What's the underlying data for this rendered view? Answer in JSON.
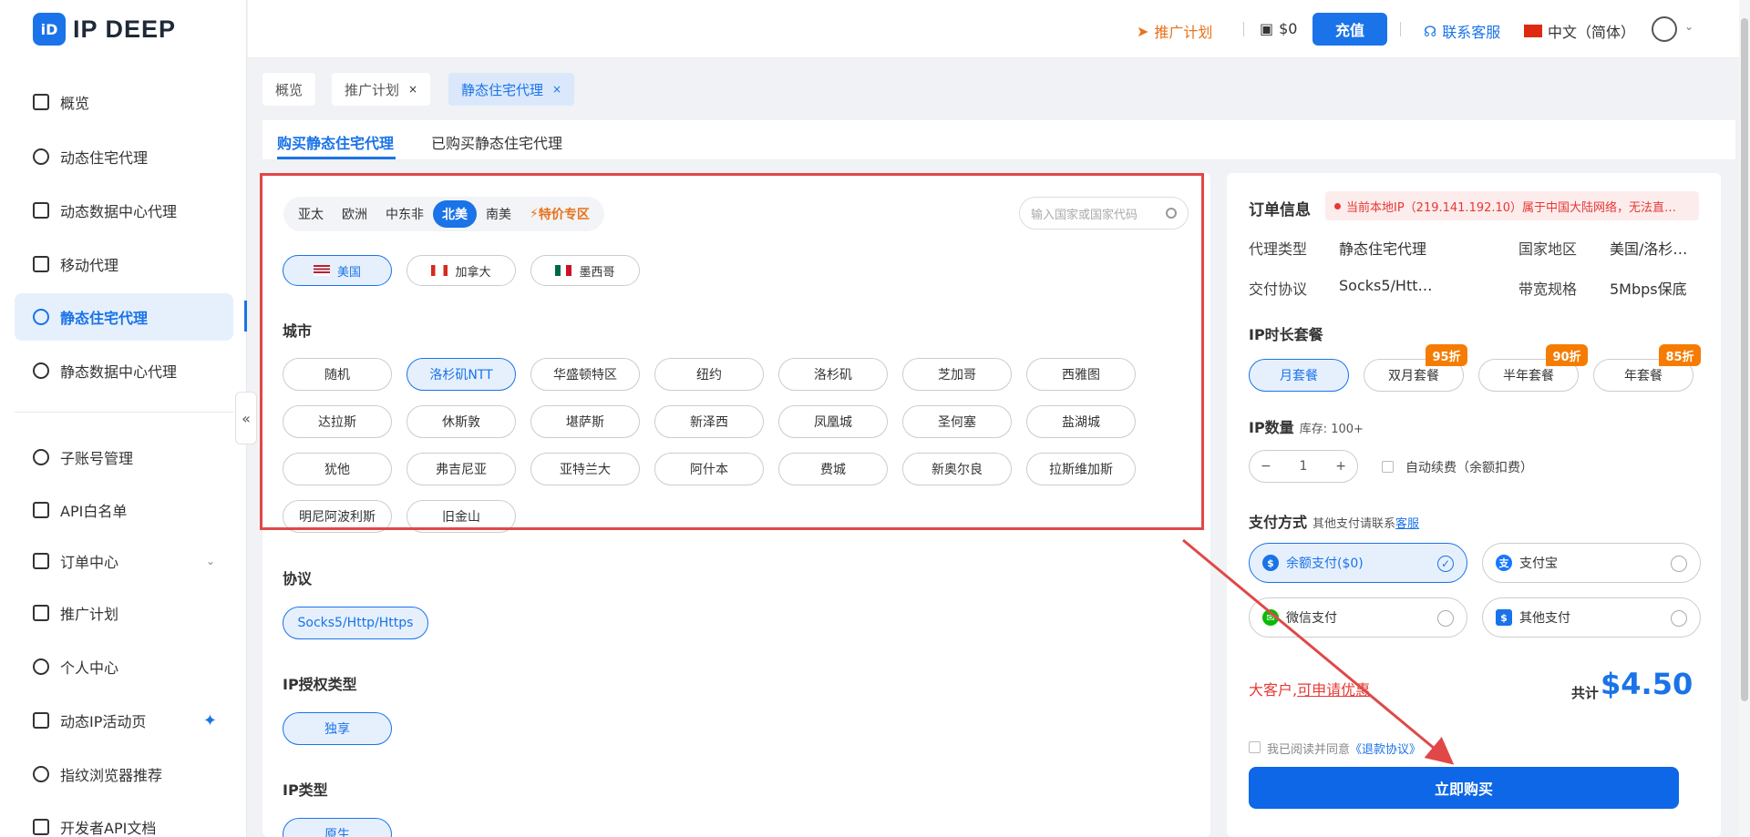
{
  "brand": {
    "logo_mark": "iD",
    "name": "IP DEEP"
  },
  "header": {
    "promo": "推广计划",
    "balance": "$0",
    "topup": "充值",
    "support": "联系客服",
    "language": "中文（简体）"
  },
  "sidebar": {
    "items": [
      {
        "label": "概览"
      },
      {
        "label": "动态住宅代理"
      },
      {
        "label": "动态数据中心代理"
      },
      {
        "label": "移动代理"
      },
      {
        "label": "静态住宅代理"
      },
      {
        "label": "静态数据中心代理"
      },
      {
        "label": "子账号管理"
      },
      {
        "label": "API白名单"
      },
      {
        "label": "订单中心"
      },
      {
        "label": "推广计划"
      },
      {
        "label": "个人中心"
      },
      {
        "label": "动态IP活动页"
      },
      {
        "label": "指纹浏览器推荐"
      },
      {
        "label": "开发者API文档"
      }
    ],
    "collapse": "«"
  },
  "tabs": [
    {
      "label": "概览"
    },
    {
      "label": "推广计划"
    },
    {
      "label": "静态住宅代理"
    }
  ],
  "tab_close": "×",
  "subtabs": [
    "购买静态住宅代理",
    "已购买静态住宅代理"
  ],
  "regions": [
    "亚太",
    "欧洲",
    "中东非",
    "北美",
    "南美",
    "特价专区"
  ],
  "search_placeholder": "输入国家或国家代码",
  "countries": [
    "美国",
    "加拿大",
    "墨西哥"
  ],
  "city_title": "城市",
  "cities": [
    "随机",
    "洛杉矶NTT",
    "华盛顿特区",
    "纽约",
    "洛杉矶",
    "芝加哥",
    "西雅图",
    "达拉斯",
    "休斯敦",
    "堪萨斯",
    "新泽西",
    "凤凰城",
    "圣何塞",
    "盐湖城",
    "犹他",
    "弗吉尼亚",
    "亚特兰大",
    "阿什本",
    "费城",
    "新奥尔良",
    "拉斯维加斯",
    "明尼阿波利斯",
    "旧金山"
  ],
  "protocol_title": "协议",
  "protocol": "Socks5/Http/Https",
  "auth_title": "IP授权类型",
  "auth": "独享",
  "iptype_title": "IP类型",
  "iptype": "原生",
  "order": {
    "title": "订单信息",
    "warning": "当前本地IP（219.141.192.10）属于中国大陆网络，无法直…",
    "proxy_type_k": "代理类型",
    "proxy_type_v": "静态住宅代理",
    "region_k": "国家地区",
    "region_v": "美国/洛杉…",
    "protocol_k": "交付协议",
    "protocol_v": "Socks5/Htt…",
    "bandwidth_k": "带宽规格",
    "bandwidth_v": "5Mbps保底",
    "package_title": "IP时长套餐",
    "packages": [
      "月套餐",
      "双月套餐",
      "半年套餐",
      "年套餐"
    ],
    "discounts": [
      "95折",
      "90折",
      "85折"
    ],
    "qty_title": "IP数量",
    "stock": "库存: 100+",
    "qty_minus": "−",
    "qty_value": "1",
    "qty_plus": "+",
    "auto_renew": "自动续费（余额扣费）",
    "pay_title": "支付方式",
    "pay_hint": "其他支付请联系",
    "pay_hint_link": "客服",
    "pay_methods": [
      "余额支付($0)",
      "支付宝",
      "微信支付",
      "其他支付"
    ],
    "big_customer": "大客户,",
    "big_customer_link": "可申请优惠",
    "total_label": "共计",
    "total": "$4.50",
    "agree_text": "我已阅读并同意",
    "agree_link": "《退款协议》",
    "buy": "立即购买"
  },
  "colors": {
    "accent": "#1a73e8",
    "warning": "#e53935",
    "promo": "#e8711a",
    "annotation": "#e04848"
  }
}
